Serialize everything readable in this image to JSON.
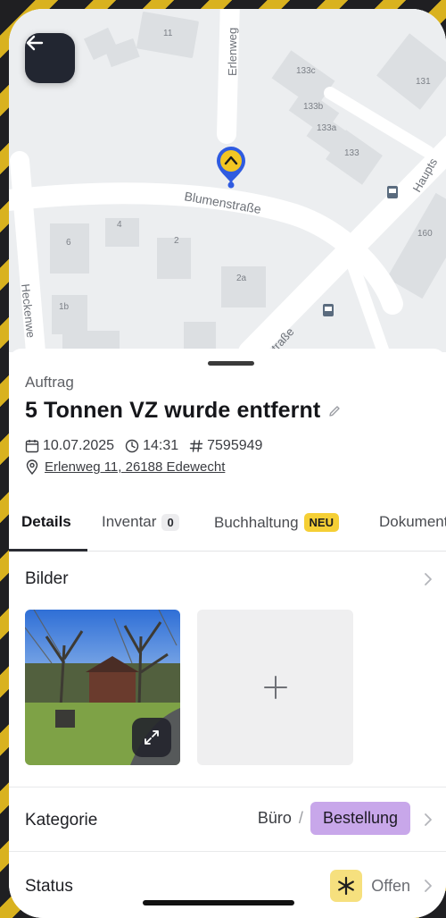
{
  "map": {
    "street_erlenweg": "Erlenweg",
    "street_blumenstrasse": "Blumenstraße",
    "street_heckenweg": "Heckenwe",
    "street_haupt": "Haupts",
    "street_strasse": "traße",
    "house_numbers": [
      "11",
      "133c",
      "131",
      "133b",
      "133a",
      "133",
      "6",
      "4",
      "2",
      "160",
      "2a",
      "1b"
    ]
  },
  "order": {
    "kind_label": "Auftrag",
    "title": "5 Tonnen VZ wurde entfernt",
    "date": "10.07.2025",
    "time": "14:31",
    "number": "7595949",
    "address": "Erlenweg 11, 26188 Edewecht"
  },
  "tabs": [
    {
      "label": "Details"
    },
    {
      "label": "Inventar",
      "count": "0"
    },
    {
      "label": "Buchhaltung",
      "badge": "NEU"
    },
    {
      "label": "Dokumente"
    }
  ],
  "sections": {
    "bilder_label": "Bilder",
    "kategorie_label": "Kategorie",
    "kategorie_parent": "Büro",
    "kategorie_separator": "/",
    "kategorie_value": "Bestellung",
    "status_label": "Status",
    "status_value": "Offen"
  },
  "colors": {
    "accent_dark": "#222631",
    "category_pill": "#c8a7ea",
    "badge_new": "#f5cf35",
    "status_icon_bg": "#f6e07e",
    "pin_yellow": "#f3c623",
    "pin_blue": "#2f5be0"
  },
  "icons": [
    "back-arrow-icon",
    "map-pin-icon",
    "edit-pencil-icon",
    "calendar-icon",
    "clock-icon",
    "hash-icon",
    "location-pin-icon",
    "chevron-right-icon",
    "expand-icon",
    "plus-icon",
    "status-asterisk-icon",
    "bus-stop-icon"
  ]
}
